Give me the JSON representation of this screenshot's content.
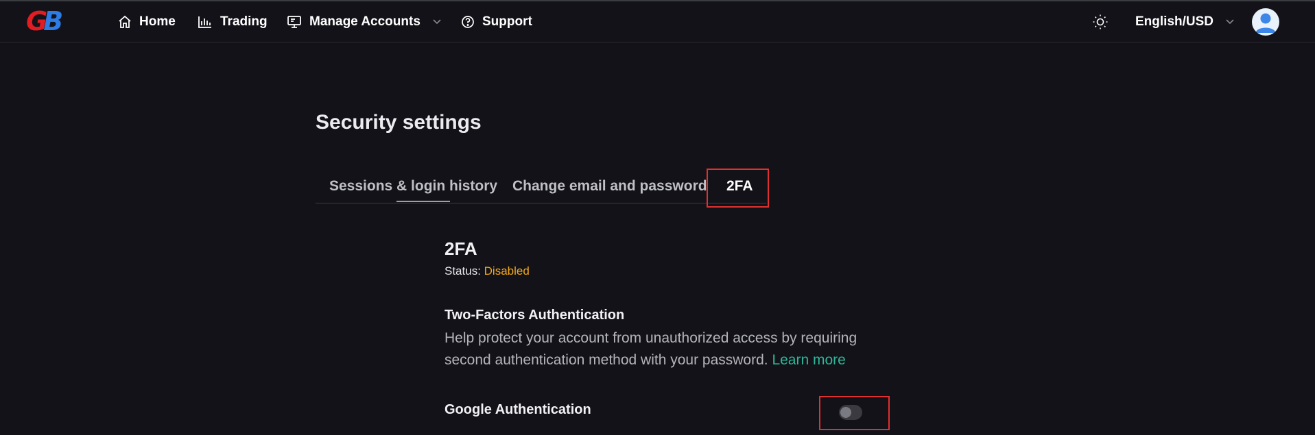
{
  "logo": {
    "text_g": "G",
    "text_b": "B"
  },
  "nav": {
    "home": "Home",
    "trading": "Trading",
    "manage_accounts": "Manage Accounts",
    "support": "Support",
    "language": "English/USD"
  },
  "page": {
    "title": "Security settings",
    "tabs": [
      {
        "label": "Sessions & login history"
      },
      {
        "label": "Change email and password"
      },
      {
        "label": "2FA",
        "active": true
      }
    ]
  },
  "twofa": {
    "heading": "2FA",
    "status_label": "Status:",
    "status_value": "Disabled",
    "subheading": "Two-Factors Authentication",
    "description": "Help protect your account from unauthorized access by requiring second authentication method with your password.",
    "learn_more": "Learn more",
    "google_label": "Google Authentication",
    "google_enabled": false
  },
  "colors": {
    "background": "#131218",
    "status_disabled": "#f1a81b",
    "link": "#2bb99b",
    "highlight": "#e0302f",
    "logo_g": "#e11c22",
    "logo_b": "#2d7be5"
  }
}
